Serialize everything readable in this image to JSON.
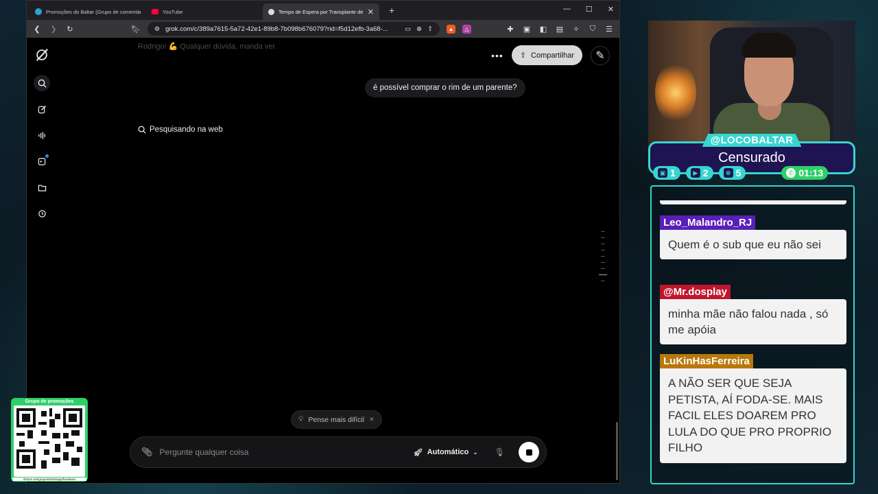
{
  "browser": {
    "tabs": [
      {
        "title": "Promoções do Baltar (Grupo de comentários)",
        "favicon_color": "#2aa3d8",
        "active": false
      },
      {
        "title": "YouTube",
        "favicon_color": "#ff0033",
        "active": false
      },
      {
        "title": "Tempo de Espera por Transplante de Rim",
        "favicon_color": "#dddddd",
        "active": true
      }
    ],
    "new_tab": "+",
    "url": "grok.com/c/389a7615-5a72-42e1-89b8-7b098b676079?rid=f5d12efb-3a68-..."
  },
  "grok": {
    "faded_previous_text": "Rodrigo! 💪 Qualquer dúvida, manda ver.",
    "share_label": "Compartilhar",
    "user_message": "é possível comprar o rim de um parente?",
    "search_status": "Pesquisando na web",
    "think_harder_label": "Pense mais difícil",
    "composer_placeholder": "Pergunte qualquer coisa",
    "model_label": "Automático"
  },
  "overlay": {
    "handle": "@LOCOBALTAR",
    "status": "Censurado",
    "stats": {
      "twitch": "1",
      "youtube": "2",
      "kick": "5",
      "timer": "01:13"
    },
    "accent_color": "#36d6d0",
    "chat": [
      {
        "author": "Leo_Malandro_RJ",
        "author_color": "#5a1fb8",
        "text": "Quem é o sub que eu não sei"
      },
      {
        "author": "@Mr.dosplay",
        "author_color": "#c0162d",
        "text": "minha mãe não falou nada , só me apóia"
      },
      {
        "author": "LuKinHasFerreira",
        "author_color": "#b8780a",
        "text": "A NÃO SER QUE SEJA PETISTA, AÍ FODA-SE. MAIS FACIL ELES DOAREM PRO LULA DO QUE PRO PROPRIO FILHO"
      }
    ]
  },
  "promo": {
    "title": "Grupo de promoções",
    "url": "rbstore.net/grupos/whatsapp/hardware"
  }
}
